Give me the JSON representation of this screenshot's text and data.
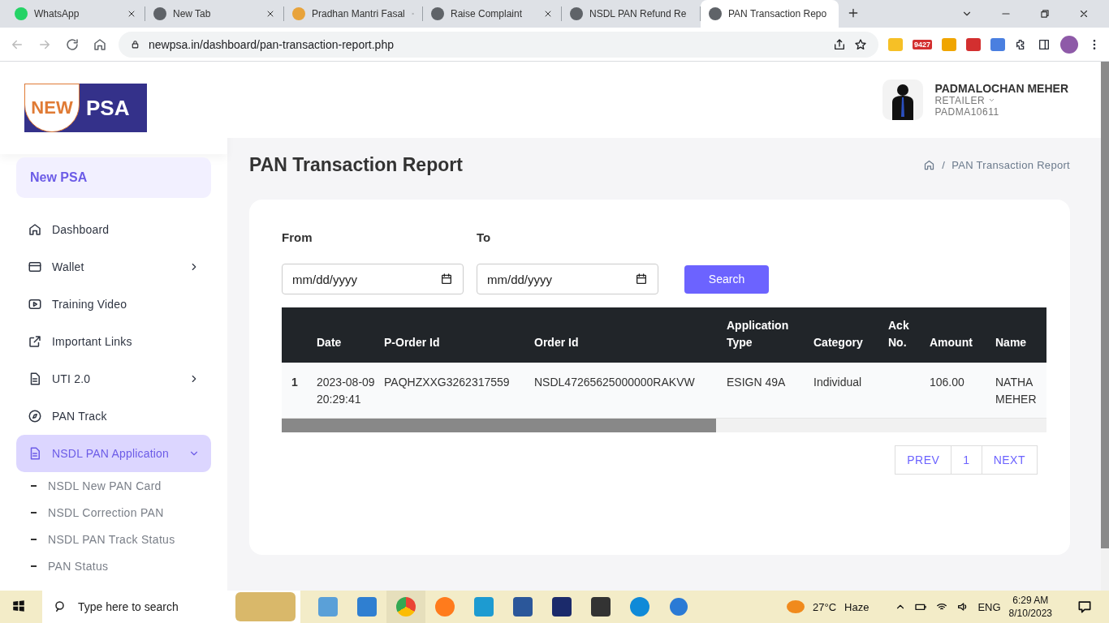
{
  "browser": {
    "tabs": [
      {
        "title": "WhatsApp",
        "selected": false
      },
      {
        "title": "New Tab",
        "selected": false
      },
      {
        "title": "Pradhan Mantri Fasal",
        "selected": false
      },
      {
        "title": "Raise Complaint",
        "selected": false
      },
      {
        "title": "NSDL PAN Refund Re",
        "selected": false
      },
      {
        "title": "PAN Transaction Repo",
        "selected": true
      }
    ],
    "url": "newpsa.in/dashboard/pan-transaction-report.php",
    "mail_badge": "9427"
  },
  "sidebar": {
    "logo": {
      "left": "NEW",
      "right": "PSA"
    },
    "brand": "New PSA",
    "items": [
      {
        "label": "Dashboard",
        "kind": "link",
        "selected": false
      },
      {
        "label": "Wallet",
        "kind": "group",
        "expanded": false,
        "selected": false
      },
      {
        "label": "Training Video",
        "kind": "link",
        "selected": false
      },
      {
        "label": "Important Links",
        "kind": "link",
        "selected": false
      },
      {
        "label": "UTI 2.0",
        "kind": "group",
        "expanded": false,
        "selected": false
      },
      {
        "label": "PAN Track",
        "kind": "link",
        "selected": false
      },
      {
        "label": "NSDL PAN Application",
        "kind": "group",
        "expanded": true,
        "selected": true,
        "children": [
          {
            "label": "NSDL New PAN Card"
          },
          {
            "label": "NSDL Correction PAN"
          },
          {
            "label": "NSDL PAN Track Status"
          },
          {
            "label": "PAN Status"
          }
        ]
      }
    ]
  },
  "user": {
    "name": "PADMALOCHAN MEHER",
    "role": "RETAILER",
    "id": "PADMA10611"
  },
  "page": {
    "title": "PAN Transaction Report",
    "breadcrumb_separator": "/",
    "breadcrumb": "PAN Transaction Report"
  },
  "filters": {
    "from_label": "From",
    "to_label": "To",
    "from_placeholder": "mm/dd/yyyy",
    "to_placeholder": "mm/dd/yyyy",
    "search_button": "Search"
  },
  "table": {
    "columns": [
      "Date",
      "P-Order Id",
      "Order Id",
      "Application Type",
      "Category",
      "Ack No.",
      "Amount",
      "Name"
    ],
    "rows": [
      {
        "index": "1",
        "cells": [
          "2023-08-09 20:29:41",
          "PAQHZXXG3262317559",
          "NSDL47265625000000RAKVW",
          "ESIGN 49A",
          "Individual",
          "",
          "106.00",
          "NATHA MEHER"
        ]
      }
    ]
  },
  "pagination": [
    {
      "label": "PREV",
      "selected": false
    },
    {
      "label": "1",
      "selected": false
    },
    {
      "label": "NEXT",
      "selected": false
    }
  ],
  "taskbar": {
    "search_placeholder": "Type here to search",
    "temperature": "27°C",
    "weather": "Haze",
    "language": "ENG",
    "time": "6:29 AM",
    "date": "8/10/2023"
  }
}
